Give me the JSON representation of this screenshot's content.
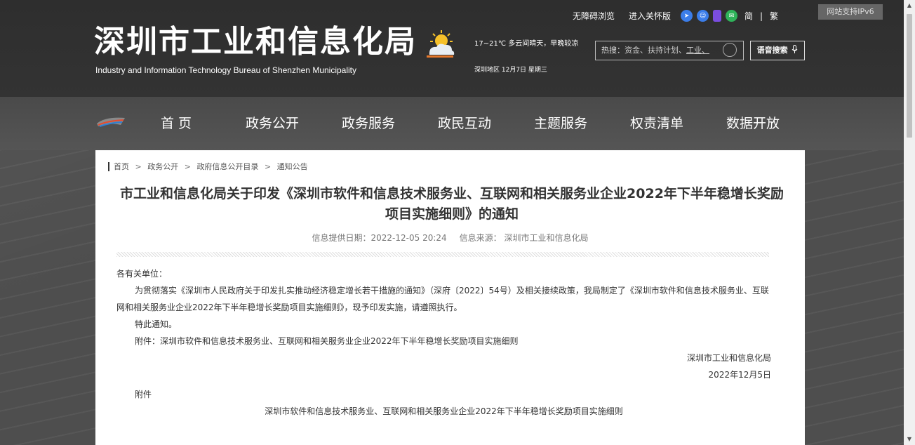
{
  "header": {
    "title": "深圳市工业和信息化局",
    "subtitle": "Industry and Information Technology Bureau of Shenzhen Municipality",
    "weather": "17~21℃ 多云间晴天，早晚较凉",
    "date_line": "深圳地区 12月7日 星期三",
    "links": {
      "accessibility": "无障碍浏览",
      "elder": "进入关怀版",
      "simplified": "简",
      "separator": "|",
      "traditional": "繁"
    },
    "ipv6": "网站支持IPv6",
    "search": {
      "hot_label": "热搜：",
      "hot_terms": "资金、扶持计划、",
      "hot_link": "工业、"
    },
    "voice_search": "语音搜索"
  },
  "nav": {
    "items": [
      {
        "label": "首 页"
      },
      {
        "label": "政务公开"
      },
      {
        "label": "政务服务"
      },
      {
        "label": "政民互动"
      },
      {
        "label": "主题服务"
      },
      {
        "label": "权责清单"
      },
      {
        "label": "数据开放"
      }
    ]
  },
  "breadcrumb": {
    "items": [
      "首页",
      "政务公开",
      "政府信息公开目录",
      "通知公告"
    ],
    "separator": ">"
  },
  "article": {
    "title": "市工业和信息化局关于印发《深圳市软件和信息技术服务业、互联网和相关服务业企业2022年下半年稳增长奖励项目实施细则》的通知",
    "date_label": "信息提供日期：2022-12-05 20:24",
    "source_label": "信息来源：  深圳市工业和信息化局",
    "salutation": "各有关单位：",
    "body": "为贯彻落实《深圳市人民政府关于印发扎实推动经济稳定增长若干措施的通知》（深府〔2022〕54号）及相关接续政策，我局制定了《深圳市软件和信息技术服务业、互联网和相关服务业企业2022年下半年稳增长奖励项目实施细则》，现予印发实施，请遵照执行。",
    "closing": "特此通知。",
    "attachment": "附件：深圳市软件和信息技术服务业、互联网和相关服务业企业2022年下半年稳增长奖励项目实施细则",
    "signer": "深圳市工业和信息化局",
    "sign_date": "2022年12月5日",
    "annex_label": "附件",
    "annex_title": "深圳市软件和信息技术服务业、互联网和相关服务业企业2022年下半年稳增长奖励项目实施细则"
  },
  "colors": {
    "header_bg": "#2e2e2e",
    "icon_blue": "#3b7de9",
    "icon_purple": "#7a4de0",
    "icon_green": "#2fb35a"
  },
  "icons": [
    "weather-cloudy-sun-icon",
    "telegram-icon",
    "robot-icon",
    "mobile-icon",
    "wechat-icon",
    "search-icon",
    "microphone-icon"
  ]
}
